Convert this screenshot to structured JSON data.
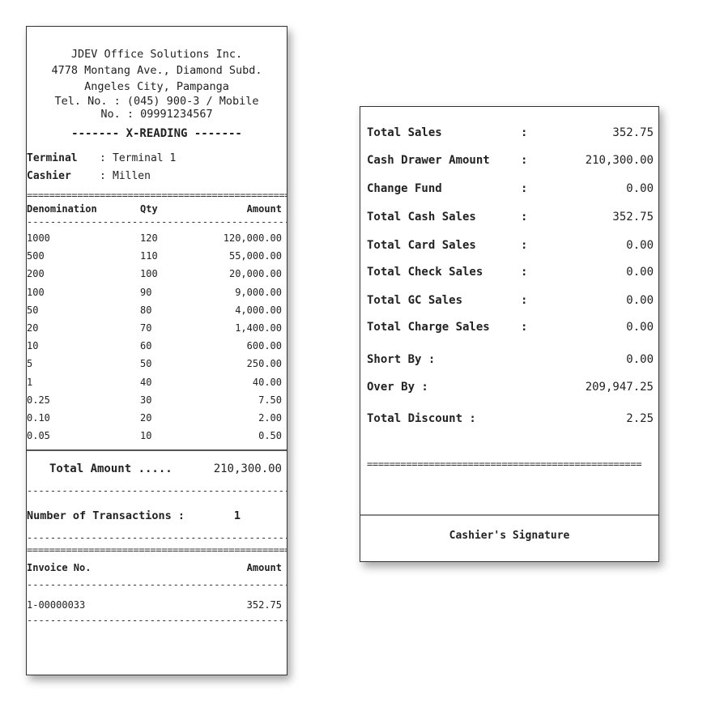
{
  "header": {
    "company": "JDEV Office Solutions Inc.",
    "address1": "4778 Montang Ave., Diamond Subd.",
    "address2": "Angeles City, Pampanga",
    "tel1": "Tel. No. : (045) 900-3 / Mobile",
    "tel2": "No. : 09991234567"
  },
  "title": "------- X-READING -------",
  "terminal": {
    "label": "Terminal",
    "sep": ":",
    "value": "Terminal 1"
  },
  "cashier": {
    "label": "Cashier",
    "sep": ":",
    "value": "Millen"
  },
  "rule_eq": "=================================================",
  "rule_dash": "--------------------------------------------------------",
  "denom_table": {
    "headers": [
      "Denomination",
      "Qty",
      "Amount"
    ],
    "rows": [
      [
        "1000",
        "120",
        "120,000.00"
      ],
      [
        "500",
        "110",
        "55,000.00"
      ],
      [
        "200",
        "100",
        "20,000.00"
      ],
      [
        "100",
        "90",
        "9,000.00"
      ],
      [
        "50",
        "80",
        "4,000.00"
      ],
      [
        "20",
        "70",
        "1,400.00"
      ],
      [
        "10",
        "60",
        "600.00"
      ],
      [
        "5",
        "50",
        "250.00"
      ],
      [
        "1",
        "40",
        "40.00"
      ],
      [
        "0.25",
        "30",
        "7.50"
      ],
      [
        "0.10",
        "20",
        "2.00"
      ],
      [
        "0.05",
        "10",
        "0.50"
      ]
    ]
  },
  "total_amount": {
    "label": "Total Amount .....",
    "value": "210,300.00"
  },
  "transactions": {
    "label": "Number of Transactions :",
    "value": "1"
  },
  "invoice_table": {
    "headers": [
      "Invoice No.",
      "Amount"
    ],
    "rows": [
      [
        "1-00000033",
        "352.75"
      ]
    ]
  },
  "summary": [
    {
      "label": "Total Sales",
      "sep": ":",
      "value": "352.75"
    },
    {
      "label": "Cash Drawer Amount",
      "sep": ":",
      "value": "210,300.00"
    },
    {
      "label": "Change Fund",
      "sep": ":",
      "value": "0.00"
    },
    {
      "label": "Total Cash Sales",
      "sep": ":",
      "value": "352.75"
    },
    {
      "label": "Total Card Sales",
      "sep": ":",
      "value": "0.00"
    },
    {
      "label": "Total Check Sales",
      "sep": ":",
      "value": "0.00"
    },
    {
      "label": "Total GC Sales",
      "sep": ":",
      "value": "0.00"
    },
    {
      "label": "Total Charge Sales",
      "sep": ":",
      "value": "0.00"
    },
    {
      "label": "Short By :",
      "sep": "",
      "value": "0.00"
    },
    {
      "label": "Over By :",
      "sep": "",
      "value": "209,947.25"
    },
    {
      "label": "Total Discount :",
      "sep": "",
      "value": "2.25"
    }
  ],
  "signature": "Cashier's Signature"
}
